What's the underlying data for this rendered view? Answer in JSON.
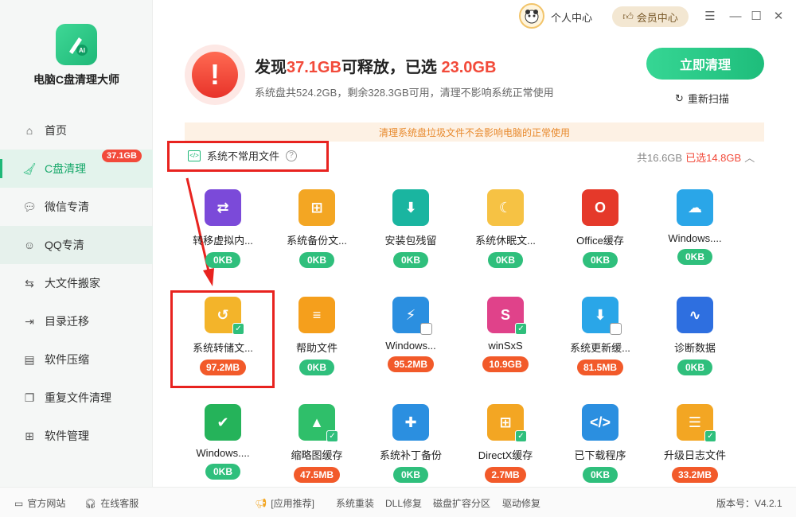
{
  "app": {
    "name": "电脑C盘清理大师"
  },
  "titlebar": {
    "personal": "个人中心",
    "vip": "会员中心"
  },
  "sidebar": {
    "items": [
      {
        "label": "首页",
        "icon": "home-icon"
      },
      {
        "label": "C盘清理",
        "icon": "broom-icon",
        "badge": "37.1GB",
        "active": true
      },
      {
        "label": "微信专清",
        "icon": "wechat-icon"
      },
      {
        "label": "QQ专清",
        "icon": "qq-icon"
      },
      {
        "label": "大文件搬家",
        "icon": "move-file-icon"
      },
      {
        "label": "目录迁移",
        "icon": "folder-migrate-icon"
      },
      {
        "label": "软件压缩",
        "icon": "compress-icon"
      },
      {
        "label": "重复文件清理",
        "icon": "duplicate-icon"
      },
      {
        "label": "软件管理",
        "icon": "apps-icon"
      }
    ]
  },
  "summary": {
    "headline_prefix": "发现",
    "found_size": "37.1GB",
    "headline_mid": "可释放，已选 ",
    "selected_size": "23.0GB",
    "subline": "系统盘共524.2GB，剩余328.3GB可用，清理不影响系统正常使用",
    "clean_button": "立即清理",
    "rescan": "重新扫描"
  },
  "banner": "清理系统盘垃圾文件不会影响电脑的正常使用",
  "category": {
    "name": "系统不常用文件",
    "total": "共16.6GB",
    "selected": "已选14.8GB"
  },
  "tiles": [
    {
      "label": "转移虚拟内...",
      "size": "0KB",
      "selected": false,
      "color": "#7b4ad9",
      "glyph": "⇄"
    },
    {
      "label": "系统备份文...",
      "size": "0KB",
      "selected": false,
      "color": "#f3a623",
      "glyph": "⊞"
    },
    {
      "label": "安装包残留",
      "size": "0KB",
      "selected": false,
      "color": "#1ab5a0",
      "glyph": "⬇"
    },
    {
      "label": "系统休眠文...",
      "size": "0KB",
      "selected": false,
      "color": "#f6c244",
      "glyph": "☾"
    },
    {
      "label": "Office缓存",
      "size": "0KB",
      "selected": false,
      "color": "#e5392a",
      "glyph": "O"
    },
    {
      "label": "Windows....",
      "size": "0KB",
      "selected": false,
      "color": "#2aa6e8",
      "glyph": "☁"
    },
    {
      "label": "系统转储文...",
      "size": "97.2MB",
      "selected": true,
      "color": "#f3b42a",
      "glyph": "↺"
    },
    {
      "label": "帮助文件",
      "size": "0KB",
      "selected": false,
      "color": "#f59f1c",
      "glyph": "≡"
    },
    {
      "label": "Windows...",
      "size": "95.2MB",
      "selected": false,
      "color": "#2b8fe0",
      "glyph": "⚡"
    },
    {
      "label": "winSxS",
      "size": "10.9GB",
      "selected": true,
      "color": "#e0428a",
      "glyph": "S"
    },
    {
      "label": "系统更新缓...",
      "size": "81.5MB",
      "selected": false,
      "color": "#2aa6e8",
      "glyph": "⬇"
    },
    {
      "label": "诊断数据",
      "size": "0KB",
      "selected": false,
      "color": "#2e6fe0",
      "glyph": "∿"
    },
    {
      "label": "Windows....",
      "size": "0KB",
      "selected": false,
      "color": "#25b35a",
      "glyph": "✔"
    },
    {
      "label": "缩略图缓存",
      "size": "47.5MB",
      "selected": true,
      "color": "#2fbf6a",
      "glyph": "▲"
    },
    {
      "label": "系统补丁备份",
      "size": "0KB",
      "selected": false,
      "color": "#2b8fe0",
      "glyph": "✚"
    },
    {
      "label": "DirectX缓存",
      "size": "2.7MB",
      "selected": true,
      "color": "#f3a623",
      "glyph": "⊞"
    },
    {
      "label": "已下载程序",
      "size": "0KB",
      "selected": false,
      "color": "#2b8fe0",
      "glyph": "</>"
    },
    {
      "label": "升级日志文件",
      "size": "33.2MB",
      "selected": true,
      "color": "#f3a623",
      "glyph": "☰"
    }
  ],
  "footer": {
    "website": "官方网站",
    "service": "在线客服",
    "recommend": "[应用推荐]",
    "links": [
      "系统重装",
      "DLL修复",
      "磁盘扩容分区",
      "驱动修复"
    ],
    "version": "版本号：V4.2.1"
  },
  "colors": {
    "accent": "#1fb878",
    "alert": "#f24a3a",
    "orange_badge": "#f25a2a"
  }
}
